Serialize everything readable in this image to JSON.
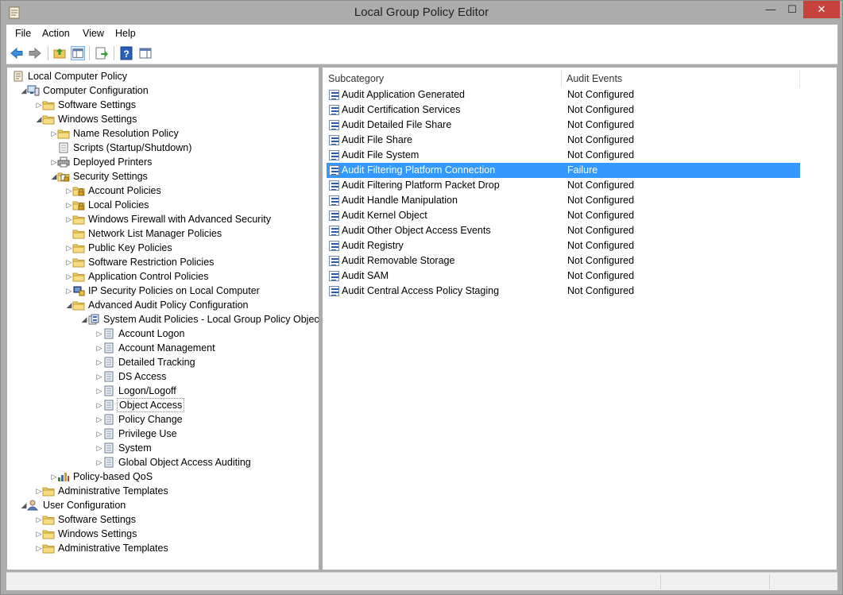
{
  "window": {
    "title": "Local Group Policy Editor",
    "minimize": "—",
    "maximize": "☐",
    "close": "✕"
  },
  "menu": [
    "File",
    "Action",
    "View",
    "Help"
  ],
  "tree": [
    {
      "label": "Local Computer Policy",
      "level": 0,
      "arrow": "",
      "icon": "policy"
    },
    {
      "label": "Computer Configuration",
      "level": 1,
      "arrow": "open",
      "icon": "computer"
    },
    {
      "label": "Software Settings",
      "level": 2,
      "arrow": "closed",
      "icon": "folder"
    },
    {
      "label": "Windows Settings",
      "level": 2,
      "arrow": "open",
      "icon": "folder"
    },
    {
      "label": "Name Resolution Policy",
      "level": 3,
      "arrow": "closed",
      "icon": "folder"
    },
    {
      "label": "Scripts (Startup/Shutdown)",
      "level": 3,
      "arrow": "",
      "icon": "script"
    },
    {
      "label": "Deployed Printers",
      "level": 3,
      "arrow": "closed",
      "icon": "printer"
    },
    {
      "label": "Security Settings",
      "level": 3,
      "arrow": "open",
      "icon": "security"
    },
    {
      "label": "Account Policies",
      "level": 4,
      "arrow": "closed",
      "icon": "lockfolder"
    },
    {
      "label": "Local Policies",
      "level": 4,
      "arrow": "closed",
      "icon": "lockfolder"
    },
    {
      "label": "Windows Firewall with Advanced Security",
      "level": 4,
      "arrow": "closed",
      "icon": "folder"
    },
    {
      "label": "Network List Manager Policies",
      "level": 4,
      "arrow": "",
      "icon": "folder"
    },
    {
      "label": "Public Key Policies",
      "level": 4,
      "arrow": "closed",
      "icon": "folder"
    },
    {
      "label": "Software Restriction Policies",
      "level": 4,
      "arrow": "closed",
      "icon": "folder"
    },
    {
      "label": "Application Control Policies",
      "level": 4,
      "arrow": "closed",
      "icon": "folder"
    },
    {
      "label": "IP Security Policies on Local Computer",
      "level": 4,
      "arrow": "closed",
      "icon": "ipsec"
    },
    {
      "label": "Advanced Audit Policy Configuration",
      "level": 4,
      "arrow": "open",
      "icon": "folder"
    },
    {
      "label": "System Audit Policies - Local Group Policy Object",
      "level": 5,
      "arrow": "open",
      "icon": "audit"
    },
    {
      "label": "Account Logon",
      "level": 6,
      "arrow": "closed",
      "icon": "auditcat"
    },
    {
      "label": "Account Management",
      "level": 6,
      "arrow": "closed",
      "icon": "auditcat"
    },
    {
      "label": "Detailed Tracking",
      "level": 6,
      "arrow": "closed",
      "icon": "auditcat"
    },
    {
      "label": "DS Access",
      "level": 6,
      "arrow": "closed",
      "icon": "auditcat"
    },
    {
      "label": "Logon/Logoff",
      "level": 6,
      "arrow": "closed",
      "icon": "auditcat"
    },
    {
      "label": "Object Access",
      "level": 6,
      "arrow": "closed",
      "icon": "auditcat",
      "selected": true
    },
    {
      "label": "Policy Change",
      "level": 6,
      "arrow": "closed",
      "icon": "auditcat"
    },
    {
      "label": "Privilege Use",
      "level": 6,
      "arrow": "closed",
      "icon": "auditcat"
    },
    {
      "label": "System",
      "level": 6,
      "arrow": "closed",
      "icon": "auditcat"
    },
    {
      "label": "Global Object Access Auditing",
      "level": 6,
      "arrow": "closed",
      "icon": "auditcat"
    },
    {
      "label": "Policy-based QoS",
      "level": 3,
      "arrow": "closed",
      "icon": "qos"
    },
    {
      "label": "Administrative Templates",
      "level": 2,
      "arrow": "closed",
      "icon": "folder"
    },
    {
      "label": "User Configuration",
      "level": 1,
      "arrow": "open",
      "icon": "user"
    },
    {
      "label": "Software Settings",
      "level": 2,
      "arrow": "closed",
      "icon": "folder"
    },
    {
      "label": "Windows Settings",
      "level": 2,
      "arrow": "closed",
      "icon": "folder"
    },
    {
      "label": "Administrative Templates",
      "level": 2,
      "arrow": "closed",
      "icon": "folder"
    }
  ],
  "list": {
    "columns": [
      "Subcategory",
      "Audit Events"
    ],
    "rows": [
      {
        "subcategory": "Audit Application Generated",
        "events": "Not Configured"
      },
      {
        "subcategory": "Audit Certification Services",
        "events": "Not Configured"
      },
      {
        "subcategory": "Audit Detailed File Share",
        "events": "Not Configured"
      },
      {
        "subcategory": "Audit File Share",
        "events": "Not Configured"
      },
      {
        "subcategory": "Audit File System",
        "events": "Not Configured"
      },
      {
        "subcategory": "Audit Filtering Platform Connection",
        "events": "Failure",
        "selected": true
      },
      {
        "subcategory": "Audit Filtering Platform Packet Drop",
        "events": "Not Configured"
      },
      {
        "subcategory": "Audit Handle Manipulation",
        "events": "Not Configured"
      },
      {
        "subcategory": "Audit Kernel Object",
        "events": "Not Configured"
      },
      {
        "subcategory": "Audit Other Object Access Events",
        "events": "Not Configured"
      },
      {
        "subcategory": "Audit Registry",
        "events": "Not Configured"
      },
      {
        "subcategory": "Audit Removable Storage",
        "events": "Not Configured"
      },
      {
        "subcategory": "Audit SAM",
        "events": "Not Configured"
      },
      {
        "subcategory": "Audit Central Access Policy Staging",
        "events": "Not Configured"
      }
    ]
  },
  "colors": {
    "selection": "#3399ff",
    "close_button": "#c7423c"
  }
}
